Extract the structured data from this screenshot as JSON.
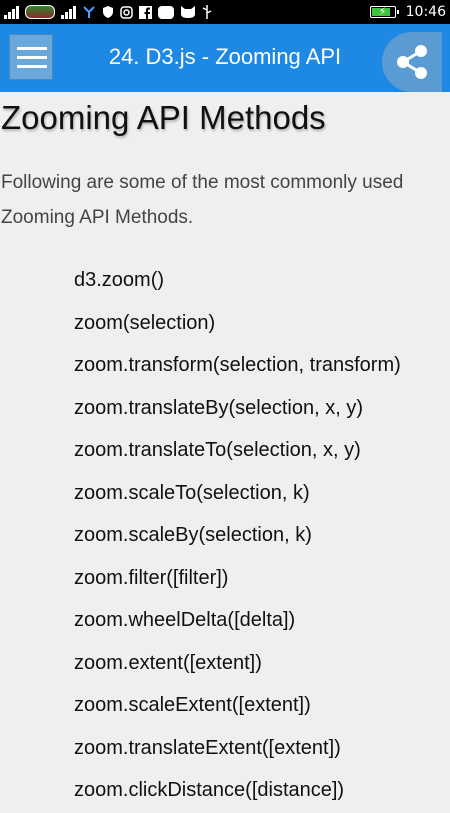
{
  "status_bar": {
    "time": "10:46",
    "icons": [
      "signal-icon",
      "carrier-icon",
      "signal-icon",
      "network-icon",
      "vpn-icon",
      "instagram-icon",
      "facebook-icon",
      "zalo-icon",
      "cat-icon",
      "usb-icon",
      "battery-icon"
    ],
    "battery_level": 0.84
  },
  "app_bar": {
    "title": "24. D3.js - Zooming API",
    "accent_color": "#1e88e5"
  },
  "content": {
    "heading": "Zooming API Methods",
    "intro": "Following are some of the most commonly used Zooming API Methods.",
    "methods": [
      "d3.zoom()",
      "zoom(selection)",
      "zoom.transform(selection, transform)",
      "zoom.translateBy(selection, x, y)",
      "zoom.translateTo(selection, x, y)",
      "zoom.scaleTo(selection, k)",
      "zoom.scaleBy(selection, k)",
      "zoom.filter([filter])",
      "zoom.wheelDelta([delta])",
      "zoom.extent([extent])",
      "zoom.scaleExtent([extent])",
      "zoom.translateExtent([extent])",
      "zoom.clickDistance([distance])"
    ]
  }
}
